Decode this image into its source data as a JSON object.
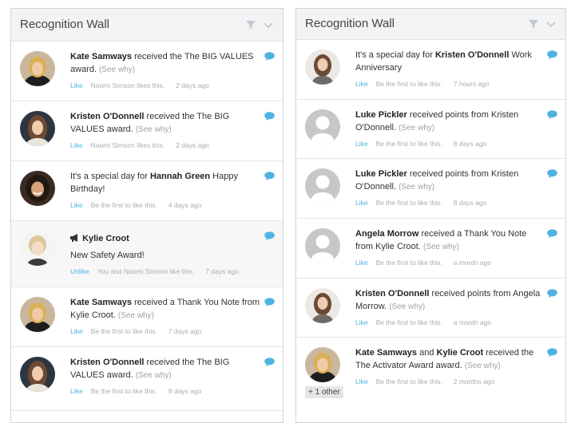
{
  "left_panel": {
    "title": "Recognition Wall",
    "items": [
      {
        "pre": "",
        "name1": "Kate Samways",
        "mid": " received the The BIG VALUES award.",
        "name2": "",
        "post": "",
        "see_why": "(See why)",
        "like": "Like",
        "who": "Naomi Simson likes this.",
        "time": "2 days ago"
      },
      {
        "pre": "",
        "name1": "Kristen O'Donnell",
        "mid": " received the The BIG VALUES award.",
        "name2": "",
        "post": "",
        "see_why": "(See why)",
        "like": "Like",
        "who": "Naomi Simson likes this.",
        "time": "2 days ago"
      },
      {
        "pre": "It's a special day for ",
        "name1": "Hannah Green",
        "mid": " Happy Birthday!",
        "name2": "",
        "post": "",
        "see_why": "",
        "like": "Like",
        "who": "Be the first to like this.",
        "time": "4 days ago"
      },
      {
        "megaphone": "Kylie Croot",
        "line2": "New Safety Award!",
        "like": "Unlike",
        "who": "You and Naomi Simson like this.",
        "time": "7 days ago"
      },
      {
        "pre": "",
        "name1": "Kate Samways",
        "mid": " received a Thank You Note from Kylie Croot.",
        "name2": "",
        "post": "",
        "see_why": "(See why)",
        "like": "Like",
        "who": "Be the first to like this.",
        "time": "7 days ago"
      },
      {
        "pre": "",
        "name1": "Kristen O'Donnell",
        "mid": " received the The BIG VALUES award.",
        "name2": "",
        "post": "",
        "see_why": "(See why)",
        "like": "Like",
        "who": "Be the first to like this.",
        "time": "8 days ago"
      }
    ]
  },
  "right_panel": {
    "title": "Recognition Wall",
    "items": [
      {
        "pre": "It's a special day for ",
        "name1": "Kristen O'Donnell",
        "mid": " Work Anniversary",
        "name2": "",
        "post": "",
        "see_why": "",
        "like": "Like",
        "who": "Be the first to like this.",
        "time": "7 hours ago"
      },
      {
        "pre": "",
        "name1": "Luke Pickler",
        "mid": " received points from Kristen O'Donnell.",
        "name2": "",
        "post": "",
        "see_why": "(See why)",
        "like": "Like",
        "who": "Be the first to like this.",
        "time": "8 days ago"
      },
      {
        "pre": "",
        "name1": "Luke Pickler",
        "mid": " received points from Kristen O'Donnell.",
        "name2": "",
        "post": "",
        "see_why": "(See why)",
        "like": "Like",
        "who": "Be the first to like this.",
        "time": "8 days ago"
      },
      {
        "pre": "",
        "name1": "Angela Morrow",
        "mid": " received a Thank You Note from Kylie Croot.",
        "name2": "",
        "post": "",
        "see_why": "(See why)",
        "like": "Like",
        "who": "Be the first to like this.",
        "time": "a month ago"
      },
      {
        "pre": "",
        "name1": "Kristen O'Donnell",
        "mid": " received points from Angela Morrow.",
        "name2": "",
        "post": "",
        "see_why": "(See why)",
        "like": "Like",
        "who": "Be the first to like this.",
        "time": "a month ago"
      },
      {
        "pre": "",
        "name1": "Kate Samways",
        "mid": " and ",
        "name2": "Kylie Croot",
        "post": " received the The Activator Award award.",
        "see_why": "(See why)",
        "like": "Like",
        "who": "Be the first to like this.",
        "time": "2 months ago",
        "plus_other": "+ 1 other"
      }
    ]
  },
  "icons": {
    "filter": "filter-icon",
    "chevron": "chevron-down-icon",
    "comment": "comment-bubble-icon",
    "megaphone": "megaphone-icon"
  },
  "colors": {
    "accent": "#4fb3e0",
    "header_bg": "#f2f3f4",
    "border": "#cfd4d8"
  }
}
